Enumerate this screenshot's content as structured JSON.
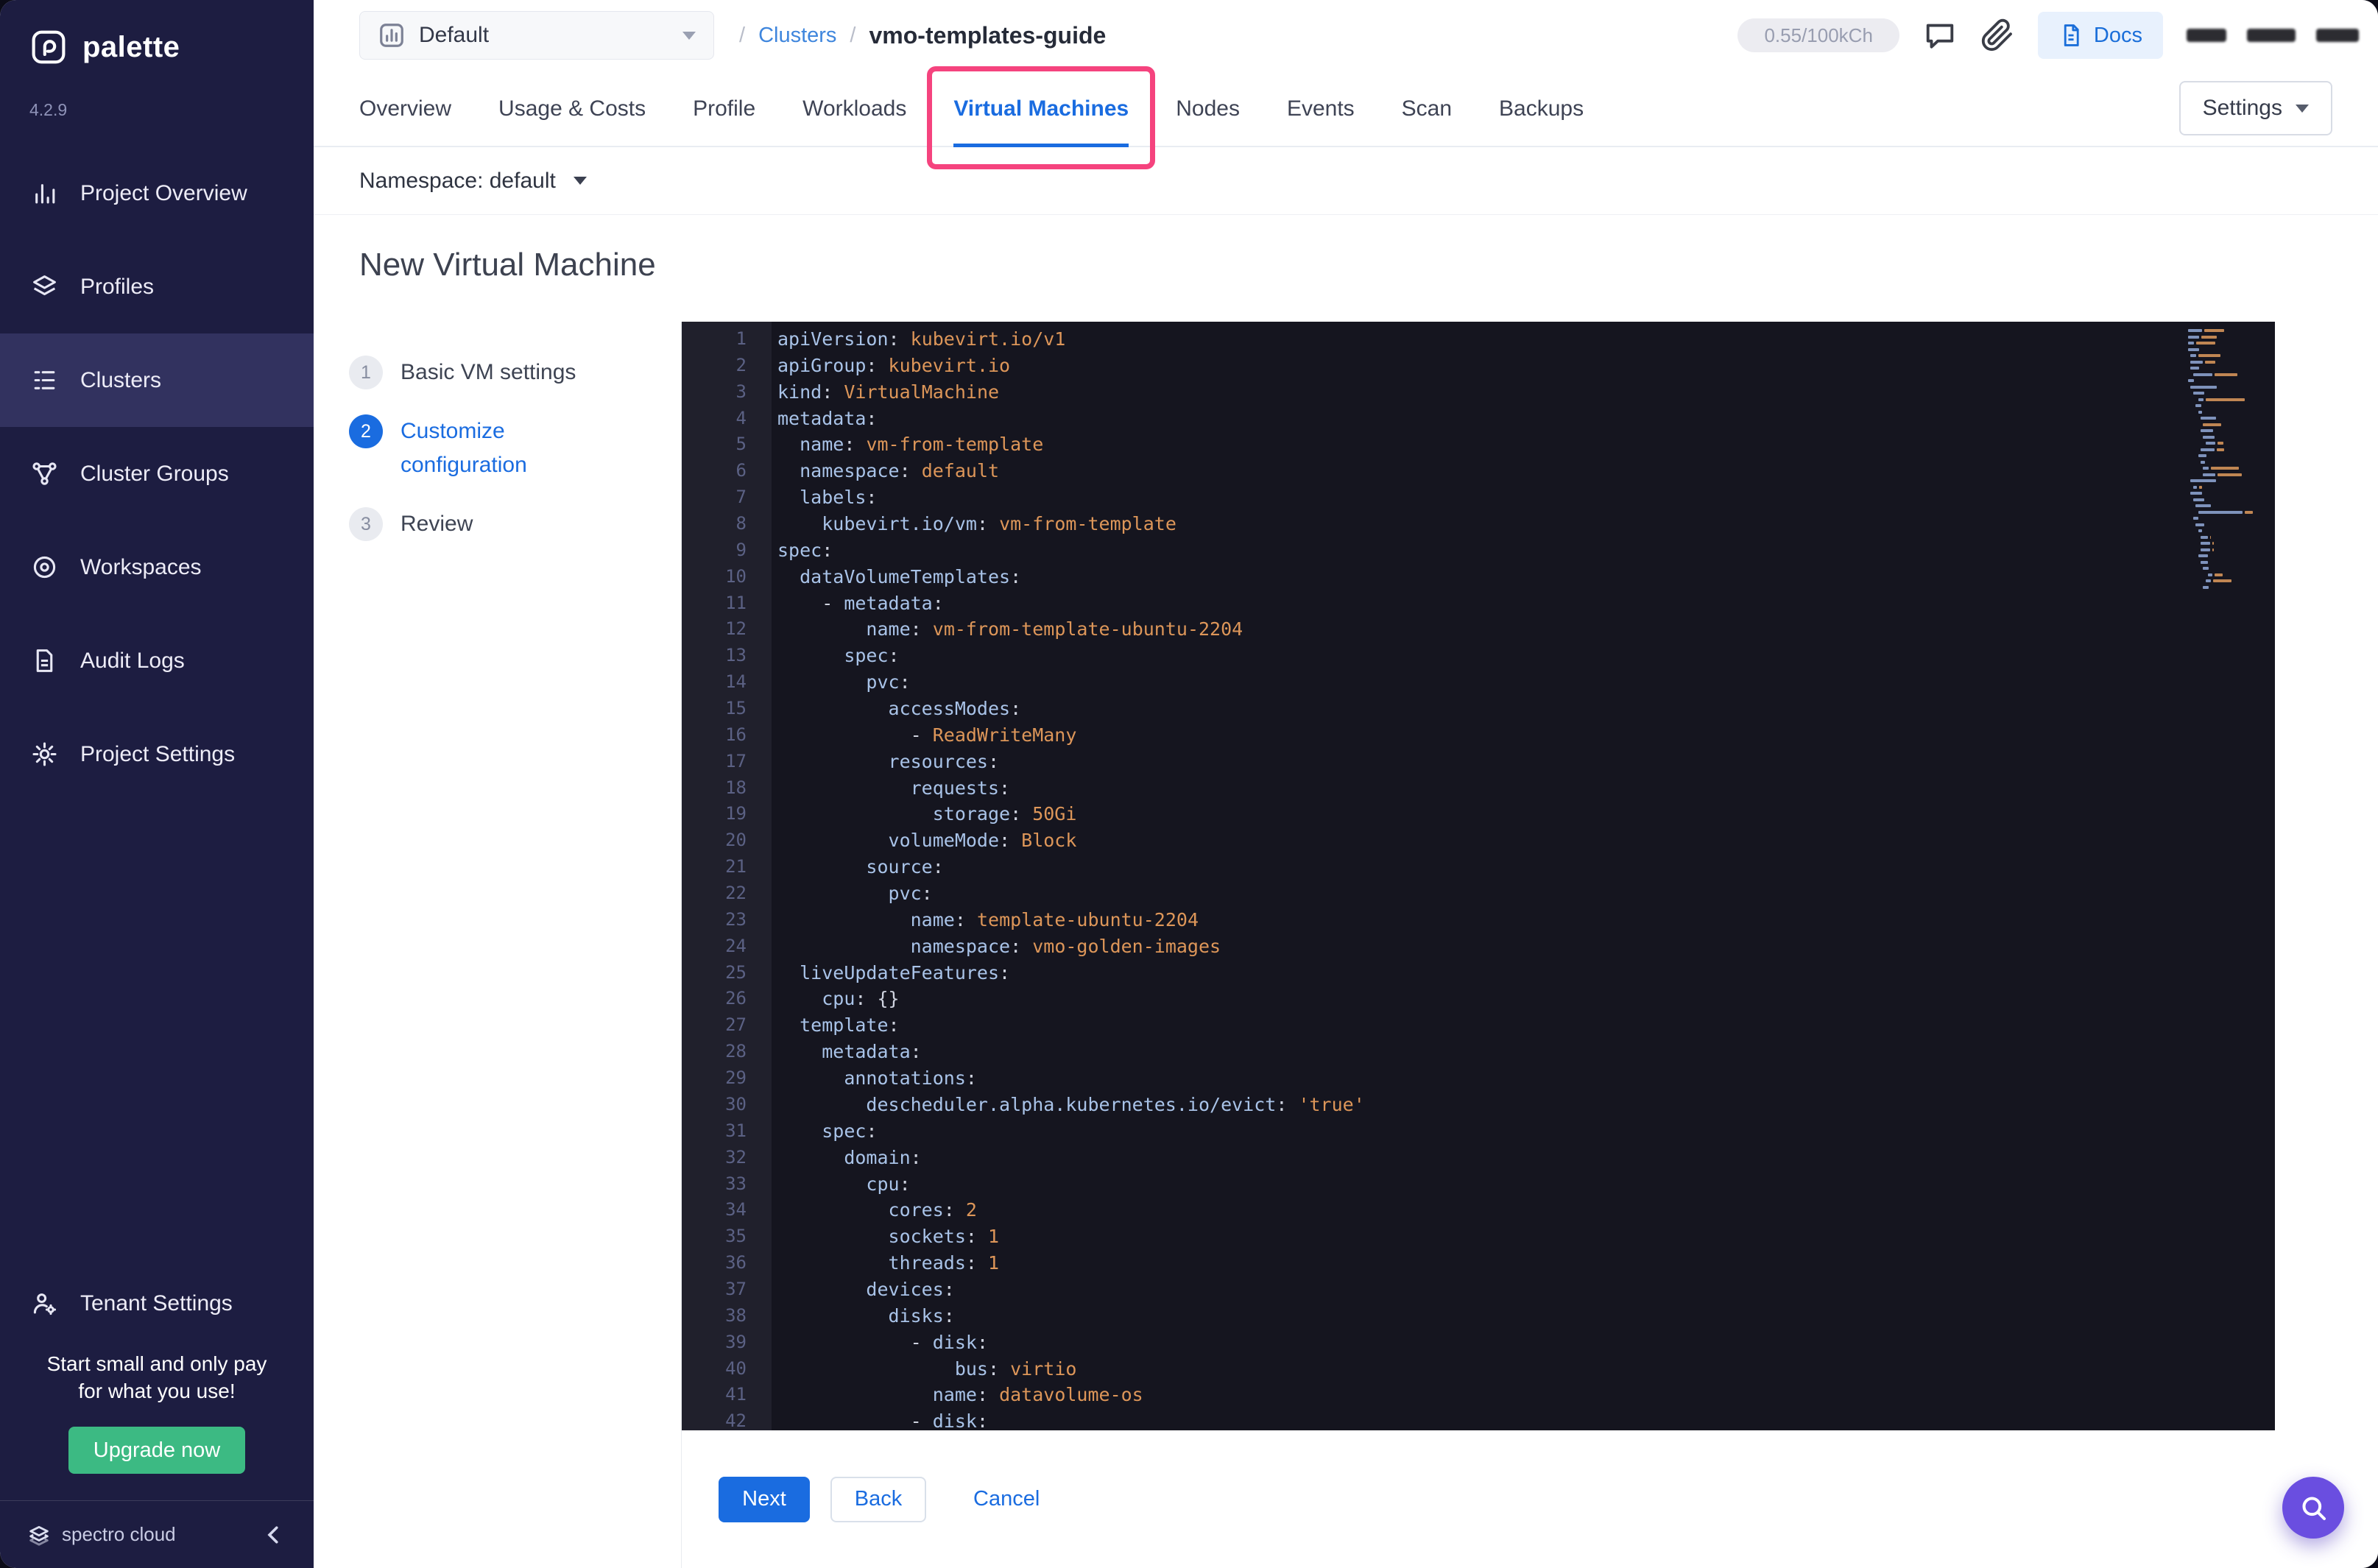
{
  "colors": {
    "accent_blue": "#1a6ce0",
    "annotation_pink": "#f5437e",
    "upgrade_green": "#3cba83",
    "editor_key": "#a9c3e8",
    "editor_value": "#dd9659",
    "sidebar_bg": "#1d1d41",
    "editor_bg": "#15151f"
  },
  "sidebar": {
    "brand": "palette",
    "version": "4.2.9",
    "items": [
      {
        "label": "Project Overview",
        "icon": "bar-chart-icon",
        "active": false
      },
      {
        "label": "Profiles",
        "icon": "layers-icon",
        "active": false
      },
      {
        "label": "Clusters",
        "icon": "list-icon",
        "active": true
      },
      {
        "label": "Cluster Groups",
        "icon": "nodes-icon",
        "active": false
      },
      {
        "label": "Workspaces",
        "icon": "target-icon",
        "active": false
      },
      {
        "label": "Audit Logs",
        "icon": "audit-icon",
        "active": false
      },
      {
        "label": "Project Settings",
        "icon": "gear-icon",
        "active": false
      }
    ],
    "secondary_items": [
      {
        "label": "Tenant Settings",
        "icon": "tenant-icon",
        "active": false
      }
    ],
    "promo": {
      "line1": "Start small and only pay",
      "line2": "for what you use!",
      "button": "Upgrade now"
    },
    "footer": {
      "brand": "spectro cloud"
    }
  },
  "header": {
    "project_selector": "Default",
    "project_selector_icon": "grid-chart-icon",
    "breadcrumb": {
      "sep": "/",
      "section": "Clusters",
      "current": "vmo-templates-guide"
    },
    "usage_pill": "0.55/100kCh",
    "docs_button": "Docs"
  },
  "tabs": {
    "items": [
      "Overview",
      "Usage & Costs",
      "Profile",
      "Workloads",
      "Virtual Machines",
      "Nodes",
      "Events",
      "Scan",
      "Backups"
    ],
    "active": "Virtual Machines",
    "settings_button": "Settings"
  },
  "annotation": {
    "target_tab": "Virtual Machines"
  },
  "toolbar": {
    "namespace_label": "Namespace: default"
  },
  "page": {
    "title": "New Virtual Machine"
  },
  "stepper": [
    {
      "num": "1",
      "label": "Basic VM settings",
      "active": false
    },
    {
      "num": "2",
      "label": "Customize configuration",
      "active": true
    },
    {
      "num": "3",
      "label": "Review",
      "active": false
    }
  ],
  "editor": {
    "lines": [
      "apiVersion: kubevirt.io/v1",
      "apiGroup: kubevirt.io",
      "kind: VirtualMachine",
      "metadata:",
      "  name: vm-from-template",
      "  namespace: default",
      "  labels:",
      "    kubevirt.io/vm: vm-from-template",
      "spec:",
      "  dataVolumeTemplates:",
      "    - metadata:",
      "        name: vm-from-template-ubuntu-2204",
      "      spec:",
      "        pvc:",
      "          accessModes:",
      "            - ReadWriteMany",
      "          resources:",
      "            requests:",
      "              storage: 50Gi",
      "          volumeMode: Block",
      "        source:",
      "          pvc:",
      "            name: template-ubuntu-2204",
      "            namespace: vmo-golden-images",
      "  liveUpdateFeatures:",
      "    cpu: {}",
      "  template:",
      "    metadata:",
      "      annotations:",
      "        descheduler.alpha.kubernetes.io/evict: 'true'",
      "    spec:",
      "      domain:",
      "        cpu:",
      "          cores: 2",
      "          sockets: 1",
      "          threads: 1",
      "        devices:",
      "          disks:",
      "            - disk:",
      "                bus: virtio",
      "              name: datavolume-os",
      "            - disk:"
    ]
  },
  "footer_actions": {
    "next": "Next",
    "back": "Back",
    "cancel": "Cancel"
  }
}
